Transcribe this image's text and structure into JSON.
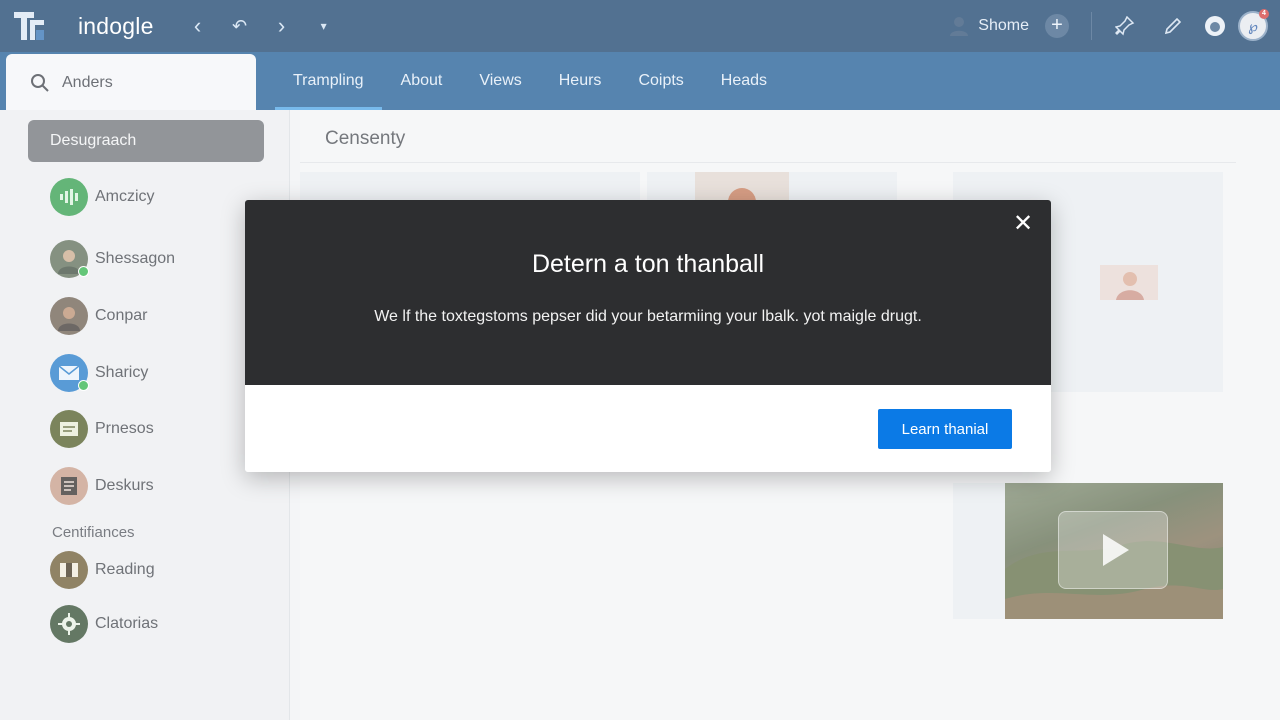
{
  "app": {
    "title": "indogle",
    "logo_icon": "tf-logo"
  },
  "topbar": {
    "back_icon": "chevron-left-icon",
    "history_icon": "history-back-icon",
    "forward_icon": "chevron-right-icon",
    "dropdown_icon": "chevron-down-icon",
    "user_label": "Shome",
    "notification_count": "4"
  },
  "search": {
    "value": "Anders"
  },
  "tabs": [
    {
      "label": "Trampling",
      "active": true
    },
    {
      "label": "About"
    },
    {
      "label": "Views"
    },
    {
      "label": "Heurs"
    },
    {
      "label": "Coipts"
    },
    {
      "label": "Heads"
    }
  ],
  "sidebar": {
    "active_item": "Desugraach",
    "items": [
      {
        "label": "Amczicy",
        "icon": "audio-icon",
        "color": "#2e9b4a"
      },
      {
        "label": "Shessagon",
        "icon": "avatar-icon",
        "color": "#5b6b55"
      },
      {
        "label": "Conpar",
        "icon": "avatar-icon",
        "color": "#6a5c4e"
      },
      {
        "label": "Sharicy",
        "icon": "mail-icon",
        "color": "#1f78c8"
      },
      {
        "label": "Prnesos",
        "icon": "document-icon",
        "color": "#4d5a24"
      },
      {
        "label": "Deskurs",
        "icon": "notes-icon",
        "color": "#c69a86"
      }
    ],
    "section_title": "Centifiances",
    "section_items": [
      {
        "label": "Reading",
        "icon": "reading-icon",
        "color": "#6a5830"
      },
      {
        "label": "Clatorias",
        "icon": "gear-icon",
        "color": "#2f4a2f"
      }
    ]
  },
  "main": {
    "title": "Censenty"
  },
  "modal": {
    "title": "Detern a ton thanball",
    "body": "We lf the toxtegstoms pepser did your betarmiing your lbalk. yot maigle drugt.",
    "button_label": "Learn thanial"
  },
  "colors": {
    "topbar": "#16406b",
    "tabbar": "#1b5a94",
    "modal_header": "#2d2e30",
    "primary_button": "#0b7ae6"
  }
}
